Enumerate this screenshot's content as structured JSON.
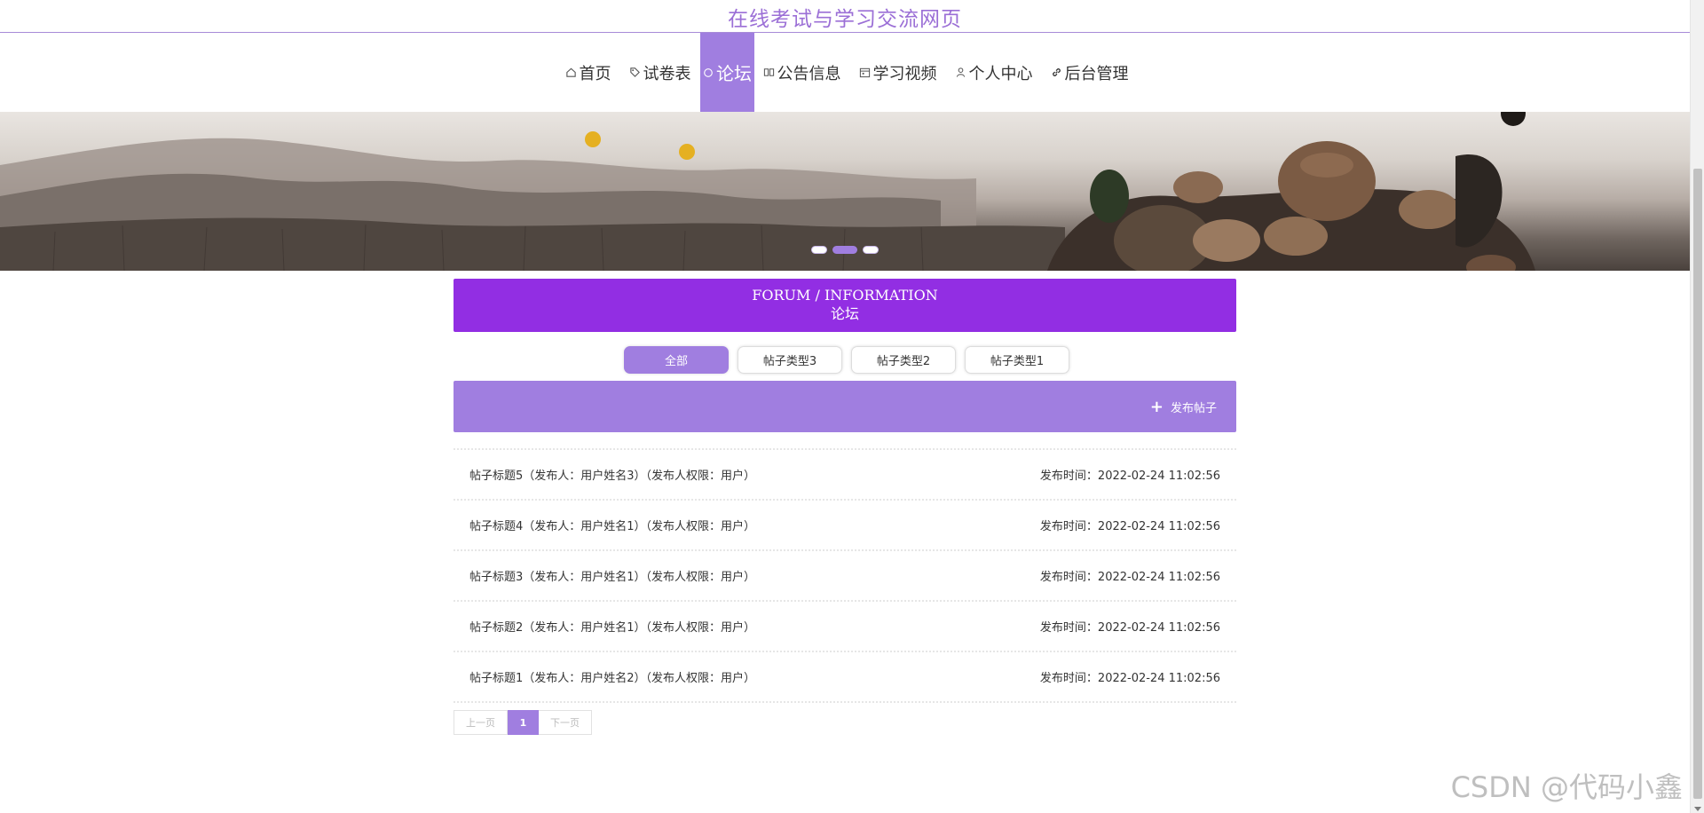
{
  "site": {
    "title": "在线考试与学习交流网页"
  },
  "nav": {
    "items": [
      {
        "label": "首页",
        "icon": "home-icon"
      },
      {
        "label": "试卷表",
        "icon": "tag-icon"
      },
      {
        "label": "论坛",
        "icon": "circle-icon",
        "active": true
      },
      {
        "label": "公告信息",
        "icon": "columns-icon"
      },
      {
        "label": "学习视频",
        "icon": "calendar-icon"
      },
      {
        "label": "个人中心",
        "icon": "user-icon"
      },
      {
        "label": "后台管理",
        "icon": "link-icon"
      }
    ]
  },
  "banner": {
    "active_slide": 2,
    "slide_count": 3
  },
  "section": {
    "title_en": "FORUM / INFORMATION",
    "title_cn": "论坛"
  },
  "filters": [
    {
      "label": "全部",
      "active": true
    },
    {
      "label": "帖子类型3"
    },
    {
      "label": "帖子类型2"
    },
    {
      "label": "帖子类型1"
    }
  ],
  "post_bar": {
    "post_button_label": "发布帖子"
  },
  "posts": [
    {
      "title": "帖子标题5（发布人：用户姓名3）（发布人权限：用户）",
      "time": "发布时间：2022-02-24 11:02:56"
    },
    {
      "title": "帖子标题4（发布人：用户姓名1）（发布人权限：用户）",
      "time": "发布时间：2022-02-24 11:02:56"
    },
    {
      "title": "帖子标题3（发布人：用户姓名1）（发布人权限：用户）",
      "time": "发布时间：2022-02-24 11:02:56"
    },
    {
      "title": "帖子标题2（发布人：用户姓名1）（发布人权限：用户）",
      "time": "发布时间：2022-02-24 11:02:56"
    },
    {
      "title": "帖子标题1（发布人：用户姓名2）（发布人权限：用户）",
      "time": "发布时间：2022-02-24 11:02:56"
    }
  ],
  "pagination": {
    "prev_label": "上一页",
    "current": "1",
    "next_label": "下一页"
  },
  "watermark": "CSDN @代码小鑫",
  "colors": {
    "accent": "#a07ee0",
    "header_purple": "#922ee3",
    "title_purple": "#9b6fd6"
  }
}
